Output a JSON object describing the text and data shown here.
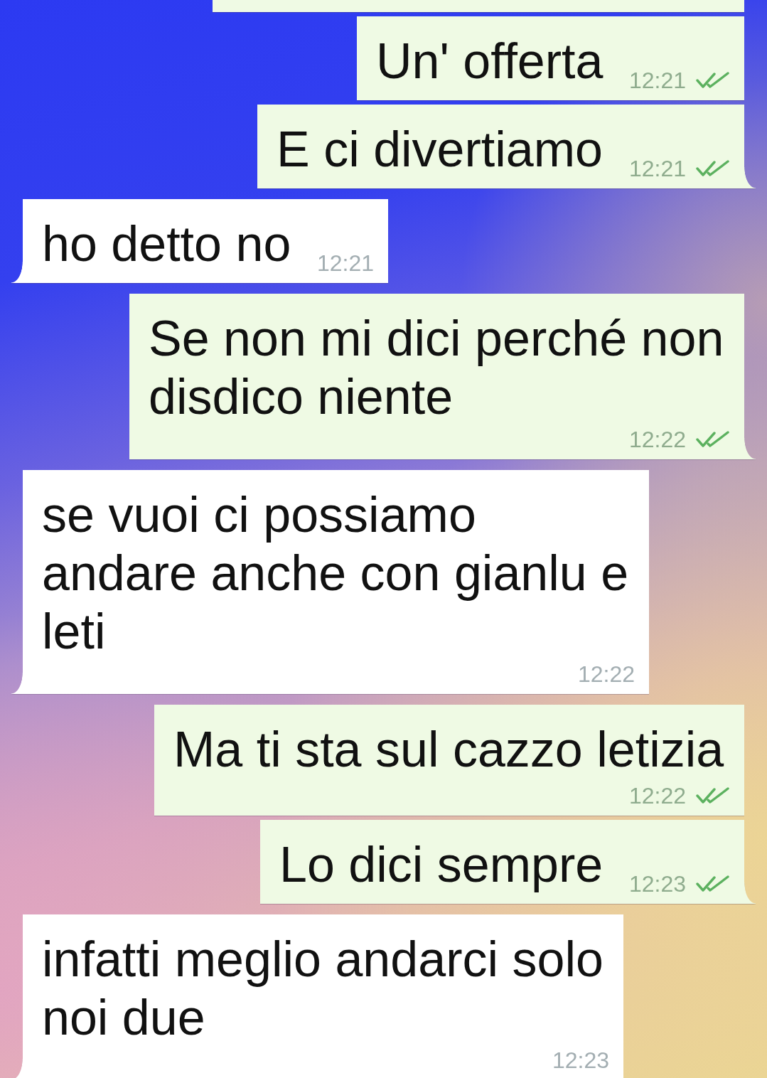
{
  "messages": [
    {
      "kind": "outgoing",
      "tail": false
    },
    {
      "kind": "outgoing",
      "tail": false,
      "text": "Un' offerta",
      "time": "12:21",
      "read": true
    },
    {
      "kind": "outgoing",
      "tail": true,
      "text": "E ci divertiamo",
      "time": "12:21",
      "read": true
    },
    {
      "kind": "incoming",
      "tail": true,
      "text": "ho detto no",
      "time": "12:21"
    },
    {
      "kind": "outgoing",
      "tail": true,
      "text": "Se non mi dici perché non disdico niente",
      "time": "12:22",
      "read": true
    },
    {
      "kind": "incoming",
      "tail": true,
      "text": "se vuoi ci possiamo andare anche con gianlu e leti",
      "time": "12:22"
    },
    {
      "kind": "outgoing",
      "tail": false,
      "text": "Ma ti sta sul cazzo letizia",
      "time": "12:22",
      "read": true
    },
    {
      "kind": "outgoing",
      "tail": true,
      "text": "Lo dici sempre",
      "time": "12:23",
      "read": true
    },
    {
      "kind": "incoming",
      "tail": true,
      "text": "infatti meglio andarci solo noi due",
      "time": "12:23"
    }
  ]
}
